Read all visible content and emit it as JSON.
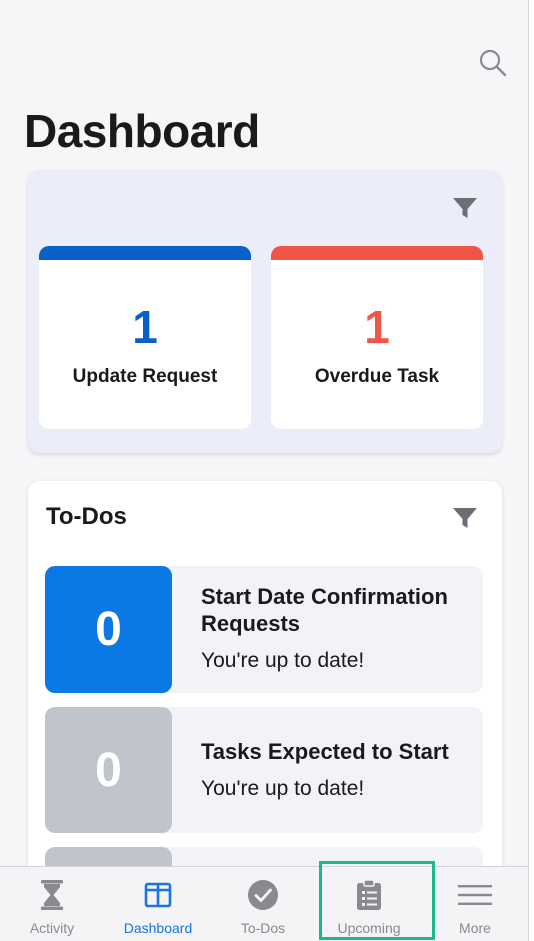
{
  "header": {
    "title": "Dashboard"
  },
  "summary": {
    "tiles": [
      {
        "value": "1",
        "label": "Update Request",
        "color": "#0a60c9"
      },
      {
        "value": "1",
        "label": "Overdue Task",
        "color": "#f05548"
      }
    ]
  },
  "todos": {
    "title": "To-Dos",
    "items": [
      {
        "count": "0",
        "title": "Start Date Confirmation Requests",
        "subtitle": "You're up to date!",
        "color": "#0b79e3"
      },
      {
        "count": "0",
        "title": "Tasks Expected to Start",
        "subtitle": "You're up to date!",
        "color": "#c1c4cb"
      },
      {
        "count": "",
        "title": "",
        "subtitle": "",
        "color": "#c1c4cb"
      }
    ]
  },
  "tabs": [
    {
      "label": "Activity",
      "icon": "hourglass-icon",
      "active": false
    },
    {
      "label": "Dashboard",
      "icon": "dashboard-icon",
      "active": true
    },
    {
      "label": "To-Dos",
      "icon": "checkmark-circle-icon",
      "active": false
    },
    {
      "label": "Upcoming",
      "icon": "clipboard-icon",
      "active": false
    },
    {
      "label": "More",
      "icon": "menu-icon",
      "active": false
    }
  ],
  "colors": {
    "accent": "#1a73e8",
    "highlight": "#1db98b"
  }
}
